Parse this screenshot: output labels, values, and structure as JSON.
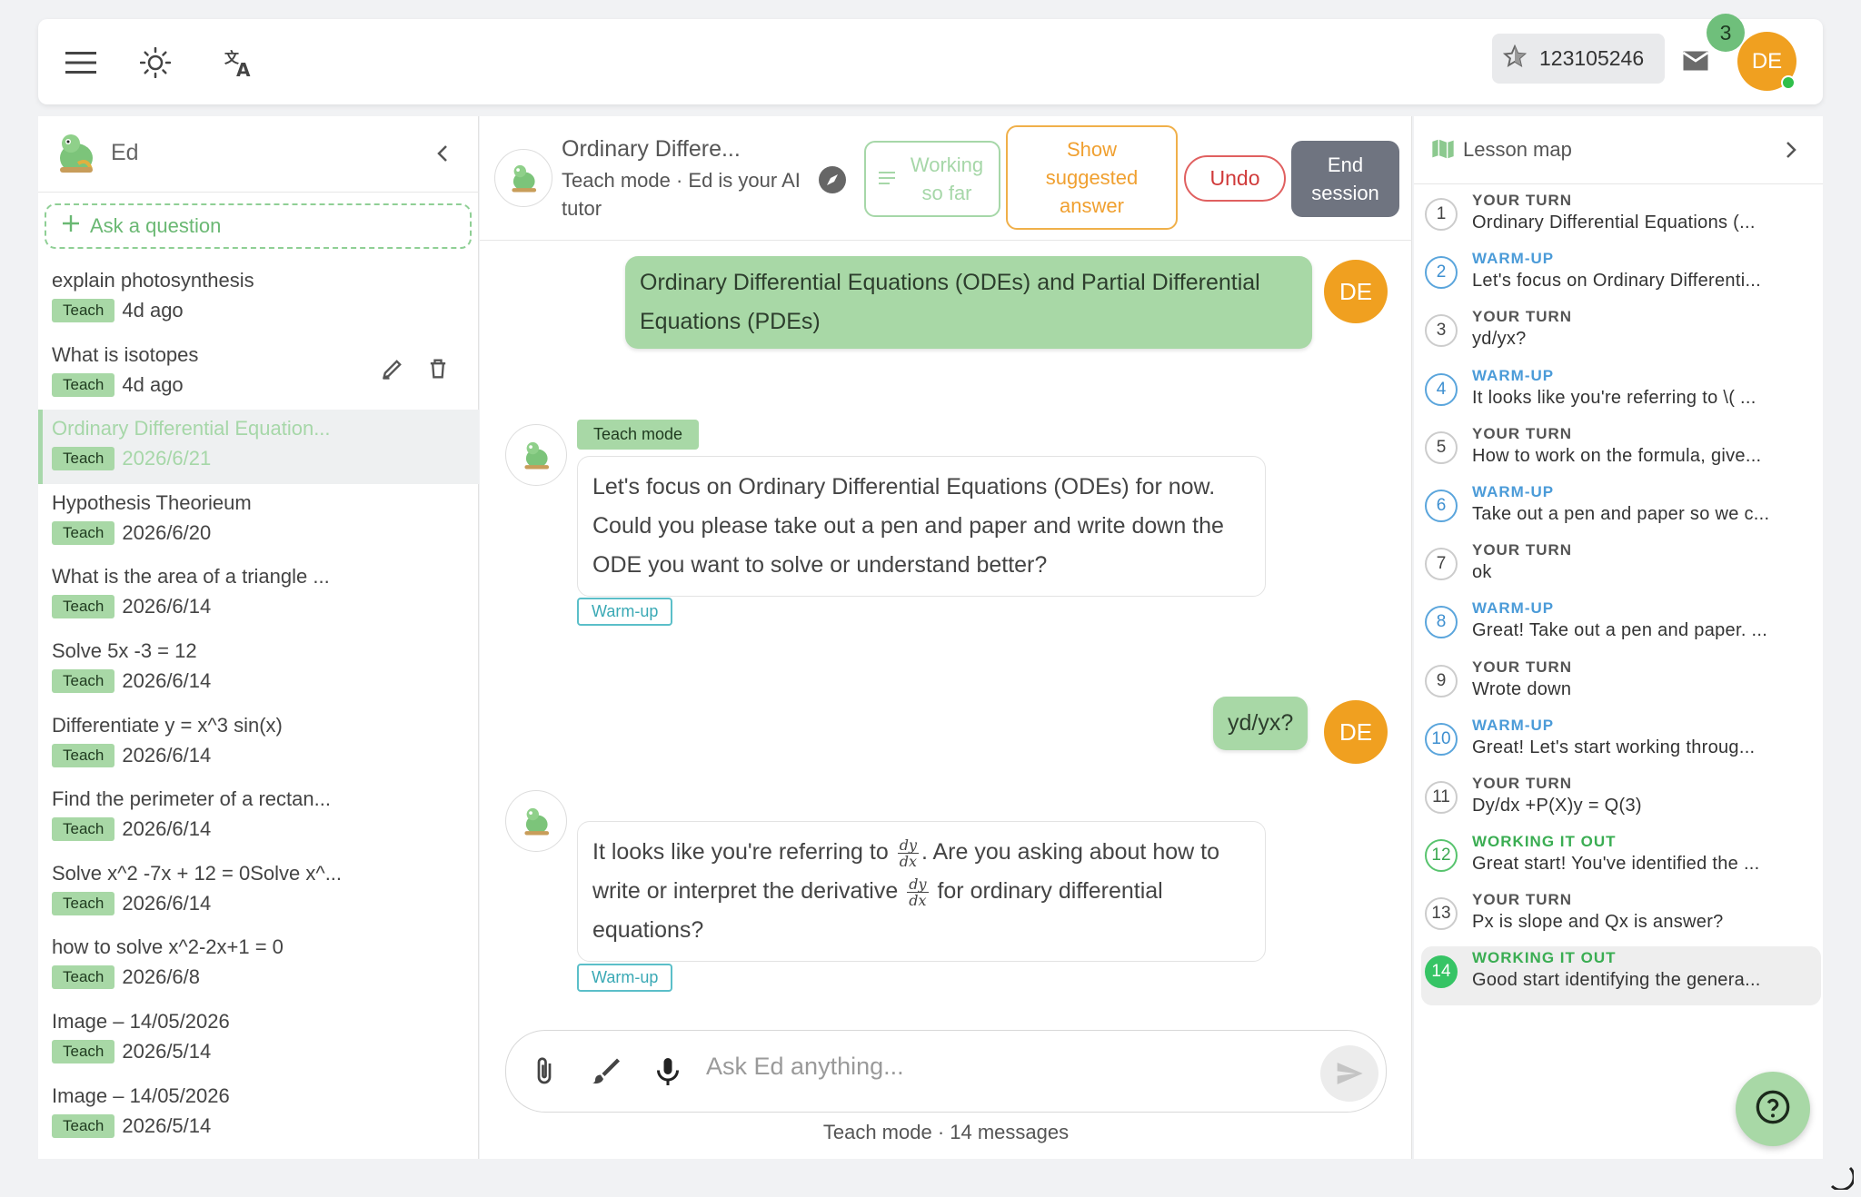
{
  "topbar": {
    "credits_value": "123105246",
    "mail_badge": "3",
    "user_initials": "DE"
  },
  "sidebar": {
    "title": "Ed",
    "ask_label": "Ask a question",
    "items": [
      {
        "question": "explain photosynthesis",
        "tag": "Teach",
        "date": "4d ago"
      },
      {
        "question": "What is isotopes",
        "tag": "Teach",
        "date": "4d ago"
      },
      {
        "question": "Ordinary Differential Equation...",
        "tag": "Teach",
        "date": "2026/6/21"
      },
      {
        "question": "Hypothesis Theorieum",
        "tag": "Teach",
        "date": "2026/6/20"
      },
      {
        "question": "What is the area of a triangle ...",
        "tag": "Teach",
        "date": "2026/6/14"
      },
      {
        "question": "Solve 5x -3 = 12",
        "tag": "Teach",
        "date": "2026/6/14"
      },
      {
        "question": "Differentiate y = x^3 sin(x)",
        "tag": "Teach",
        "date": "2026/6/14"
      },
      {
        "question": "Find the perimeter of a rectan...",
        "tag": "Teach",
        "date": "2026/6/14"
      },
      {
        "question": "Solve x^2 -7x + 12 = 0Solve x^...",
        "tag": "Teach",
        "date": "2026/6/14"
      },
      {
        "question": "how to solve x^2-2x+1 = 0",
        "tag": "Teach",
        "date": "2026/6/8"
      },
      {
        "question": "Image – 14/05/2026",
        "tag": "Teach",
        "date": "2026/5/14"
      },
      {
        "question": "Image – 14/05/2026",
        "tag": "Teach",
        "date": "2026/5/14"
      }
    ]
  },
  "chat": {
    "title": "Ordinary Differe...",
    "subtitle": "Teach mode · Ed is your AI tutor",
    "working_label": "Working so far",
    "suggest_label": "Show suggested answer",
    "undo_label": "Undo",
    "end_label": "End session",
    "messages": [
      {
        "role": "user",
        "initials": "DE",
        "text": "Ordinary Differential Equations (ODEs) and Partial Differential Equations (PDEs)"
      },
      {
        "role": "bot",
        "mode": "Teach mode",
        "text": "Let's focus on Ordinary Differential Equations (ODEs) for now. Could you please take out a pen and paper and write down the ODE you want to solve or understand better?",
        "tag": "Warm-up"
      },
      {
        "role": "user",
        "initials": "DE",
        "text": "yd/yx?"
      },
      {
        "role": "bot",
        "text_part1": "It looks like you're referring to",
        "text_part2": ". Are you asking about how to write or interpret the derivative",
        "text_part3": "for ordinary differential equations?",
        "frac_num": "dy",
        "frac_den": "dx",
        "tag": "Warm-up"
      }
    ],
    "composer_placeholder": "Ask Ed anything...",
    "footer": "Teach mode · 14 messages"
  },
  "lesson_map": {
    "title": "Lesson map",
    "items": [
      {
        "num": "1",
        "kind": "YOUR TURN",
        "text": "Ordinary Differential Equations (..."
      },
      {
        "num": "2",
        "kind": "WARM-UP",
        "text": "Let's focus on Ordinary Differenti..."
      },
      {
        "num": "3",
        "kind": "YOUR TURN",
        "text": "yd/yx?"
      },
      {
        "num": "4",
        "kind": "WARM-UP",
        "text": "It looks like you're referring to \\( ..."
      },
      {
        "num": "5",
        "kind": "YOUR TURN",
        "text": "How to work on the formula, give..."
      },
      {
        "num": "6",
        "kind": "WARM-UP",
        "text": "Take out a pen and paper so we c..."
      },
      {
        "num": "7",
        "kind": "YOUR TURN",
        "text": "ok"
      },
      {
        "num": "8",
        "kind": "WARM-UP",
        "text": "Great! Take out a pen and paper. ..."
      },
      {
        "num": "9",
        "kind": "YOUR TURN",
        "text": "Wrote down"
      },
      {
        "num": "10",
        "kind": "WARM-UP",
        "text": "Great! Let's start working throug..."
      },
      {
        "num": "11",
        "kind": "YOUR TURN",
        "text": "Dy/dx +P(X)y = Q(3)"
      },
      {
        "num": "12",
        "kind": "WORKING IT OUT",
        "text": "Great start! You've identified the ..."
      },
      {
        "num": "13",
        "kind": "YOUR TURN",
        "text": "Px is slope and Qx is answer?"
      },
      {
        "num": "14",
        "kind": "WORKING IT OUT",
        "text": "Good start identifying the genera..."
      }
    ]
  },
  "colors": {
    "accent_green": "#a8d8a6",
    "avatar_orange": "#f0a020",
    "undo_red": "#d03a3a",
    "suggest_orange": "#f0a030",
    "warm_blue": "#4b9bd8",
    "work_green": "#3aad52"
  }
}
